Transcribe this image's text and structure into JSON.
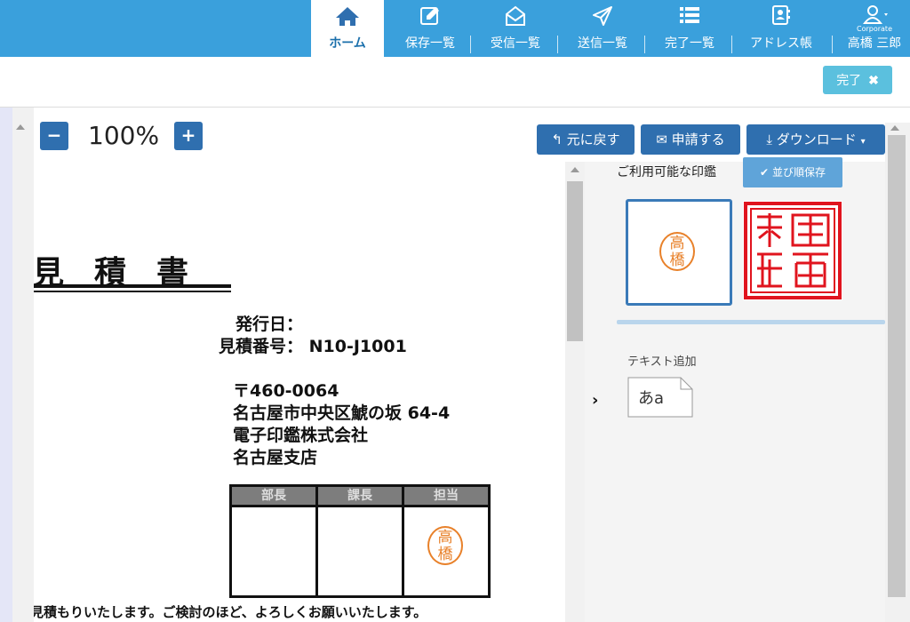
{
  "nav": {
    "items": [
      {
        "label": "ホーム",
        "icon": "home-icon"
      },
      {
        "label": "保存一覧",
        "icon": "edit-icon"
      },
      {
        "label": "受信一覧",
        "icon": "inbox-icon"
      },
      {
        "label": "送信一覧",
        "icon": "send-icon"
      },
      {
        "label": "完了一覧",
        "icon": "list-icon"
      },
      {
        "label": "アドレス帳",
        "icon": "address-book-icon"
      }
    ],
    "user": {
      "company": "Corporate",
      "name": "高橋 三郎",
      "icon": "user-icon"
    }
  },
  "subbar": {
    "done_label": "完了"
  },
  "zoom": {
    "minus": "−",
    "plus": "+",
    "level": "100%"
  },
  "toolbar": {
    "back": "元に戻す",
    "apply": "申請する",
    "download": "ダウンロード"
  },
  "document": {
    "title": "見積書",
    "issue_date_label": "発行日：",
    "quote_number": "見積番号： N10-J1001",
    "postal": "〒460-0064",
    "address": "名古屋市中央区鯱の坂 64-4",
    "company": "電子印鑑株式会社",
    "branch": "名古屋支店",
    "stamp_headers": [
      "部長",
      "課長",
      "担当"
    ],
    "footer": "見積もりいたします。ご検討のほど、よろしくお願いいたします。"
  },
  "panel": {
    "available_seals": "ご利用可能な印鑑",
    "save_order": "並び順保存",
    "text_add": "テキスト追加",
    "text_sample": "あa"
  },
  "colors": {
    "nav": "#3aa0dc",
    "primary": "#2f6faf",
    "info": "#5bc0de",
    "seal_orange": "#e8812a",
    "seal_red": "#e0141e"
  }
}
